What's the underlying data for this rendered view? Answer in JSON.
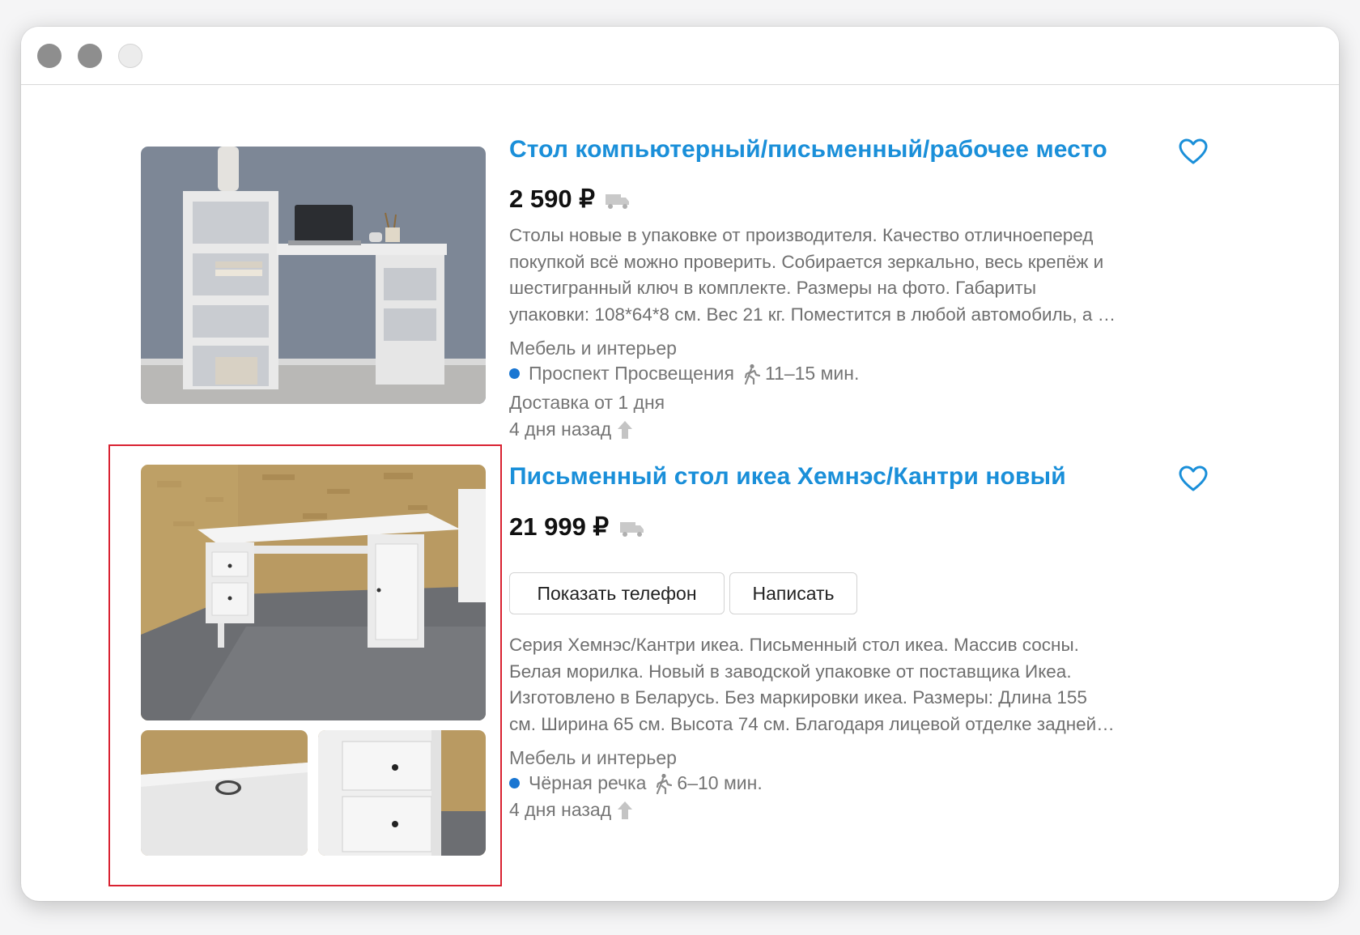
{
  "window": {
    "controls": [
      "close",
      "minimize",
      "zoom"
    ]
  },
  "listings": [
    {
      "title": "Стол компьютерный/письменный/рабочее место",
      "price": "2 590 ₽",
      "description_lines": [
        "Столы новые в упаковке от производителя. Качество отличноеперед",
        "покупкой всё можно проверить. Собирается зеркально, весь крепёж и",
        "шестигранный ключ в комплекте. Размеры на фото. Габариты",
        "упаковки: 108*64*8 см. Вес 21 кг. Поместится в любой автомобиль, а …"
      ],
      "category": "Мебель и интерьер",
      "metro": "Проспект Просвещения",
      "walk_time": "11–15 мин.",
      "delivery": "Доставка от 1 дня",
      "date": "4 дня назад",
      "icons": [
        "heart-icon",
        "truck-icon",
        "metro-dot",
        "walk-icon",
        "arrow-up-icon"
      ]
    },
    {
      "title": "Письменный стол икеа Хемнэс/Кантри новый",
      "price": "21 999 ₽",
      "buttons": {
        "phone": "Показать телефон",
        "write": "Написать"
      },
      "description_lines": [
        "Серия Хемнэс/Кантри икеа. Письменный стол икеа. Массив сосны.",
        "Белая морилка. Новый в заводской упаковке от поставщика Икеа.",
        "Изготовлено в Беларусь. Без маркировки икеа. Размеры: Длина 155",
        "см. Ширина 65 см. Высота 74 см. Благодаря лицевой отделке задней…"
      ],
      "category": "Мебель и интерьер",
      "metro": "Чёрная речка",
      "walk_time": "6–10 мин.",
      "date": "4 дня назад",
      "icons": [
        "heart-icon",
        "truck-icon",
        "metro-dot",
        "walk-icon",
        "arrow-up-icon"
      ]
    }
  ],
  "colors": {
    "link": "#1a8fd9",
    "metro_line_blue": "#1976d2",
    "highlight_frame": "#d92231",
    "muted_text": "#757575"
  }
}
